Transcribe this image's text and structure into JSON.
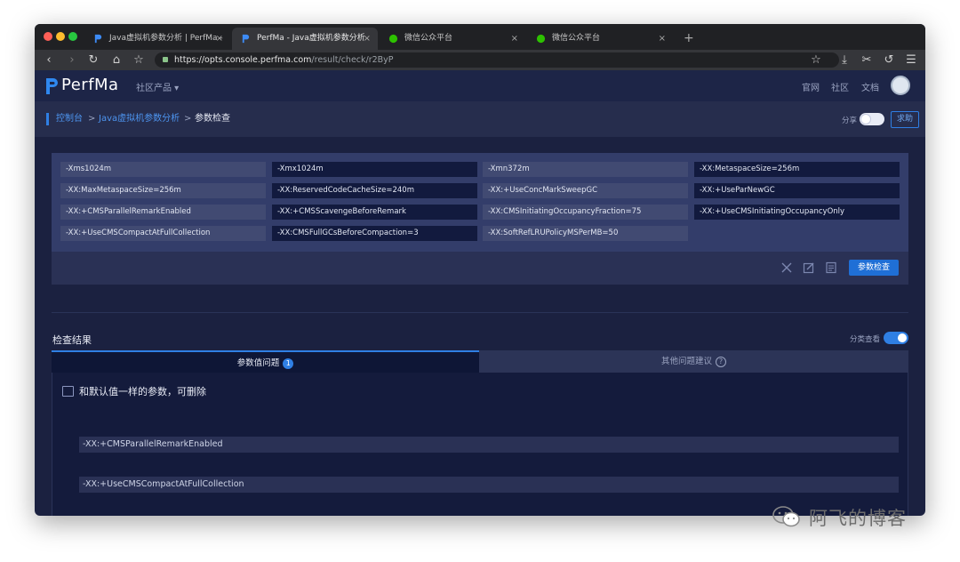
{
  "browser": {
    "tabs": [
      {
        "title": "Java虚拟机参数分析 | PerfMa -",
        "favicon": "perfma-icon"
      },
      {
        "title": "PerfMa - Java虚拟机参数分析",
        "favicon": "perfma-icon"
      },
      {
        "title": "微信公众平台",
        "favicon": "wechat-icon"
      },
      {
        "title": "微信公众平台",
        "favicon": "wechat-icon"
      }
    ],
    "tab_close": "×",
    "new_tab": "+",
    "url_host": "https://opts.console.perfma.com",
    "url_path": "/result/check/r2ByP"
  },
  "header": {
    "logo_text": "PerfMa",
    "community_menu": "社区产品 ▾",
    "links": [
      "官网",
      "社区",
      "文档"
    ]
  },
  "breadcrumb": {
    "items": [
      "控制台",
      "Java虚拟机参数分析",
      "参数检查"
    ],
    "separator": ">",
    "share_label": "分享",
    "help_button": "求助"
  },
  "params": [
    "-Xms1024m",
    "-Xmx1024m",
    "-Xmn372m",
    "-XX:MetaspaceSize=256m",
    "-XX:MaxMetaspaceSize=256m",
    "-XX:ReservedCodeCacheSize=240m",
    "-XX:+UseConcMarkSweepGC",
    "-XX:+UseParNewGC",
    "-XX:+CMSParallelRemarkEnabled",
    "-XX:+CMSScavengeBeforeRemark",
    "-XX:CMSInitiatingOccupancyFraction=75",
    "-XX:+UseCMSInitiatingOccupancyOnly",
    "-XX:+UseCMSCompactAtFullCollection",
    "-XX:CMSFullGCsBeforeCompaction=3",
    "-XX:SoftRefLRUPolicyMSPerMB=50"
  ],
  "actions": {
    "check_button": "参数检查"
  },
  "results": {
    "title": "检查结果",
    "sort_label": "分类查看",
    "tabs": [
      {
        "label": "参数值问题",
        "badge": "1"
      },
      {
        "label": "其他问题建议",
        "badge": "?"
      }
    ],
    "group_title": "和默认值一样的参数，可删除",
    "rows": [
      "-XX:+CMSParallelRemarkEnabled",
      "-XX:+UseCMSCompactAtFullCollection"
    ]
  },
  "watermark": "阿飞的博客",
  "colors": {
    "accent": "#2f7fe4",
    "page_bg": "#1b2140",
    "card_bg": "#333d6a"
  }
}
